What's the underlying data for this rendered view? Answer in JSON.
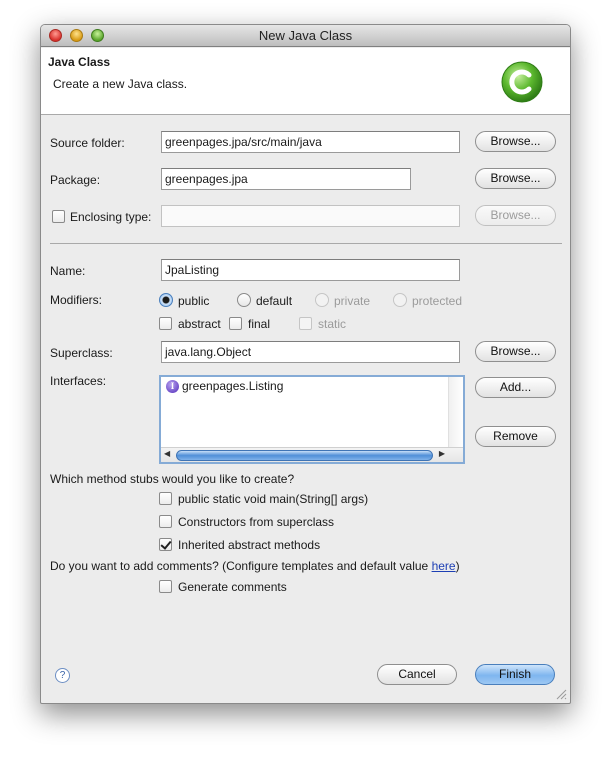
{
  "window": {
    "title": "New Java Class"
  },
  "header": {
    "title": "Java Class",
    "description": "Create a new Java class."
  },
  "source_folder": {
    "label": "Source folder:",
    "value": "greenpages.jpa/src/main/java",
    "browse_label": "Browse..."
  },
  "package": {
    "label": "Package:",
    "value": "greenpages.jpa",
    "browse_label": "Browse..."
  },
  "enclosing_type": {
    "label": "Enclosing type:",
    "value": "",
    "browse_label": "Browse...",
    "checked": false
  },
  "name": {
    "label": "Name:",
    "value": "JpaListing"
  },
  "modifiers": {
    "label": "Modifiers:",
    "access": [
      {
        "label": "public",
        "selected": true,
        "enabled": true
      },
      {
        "label": "default",
        "selected": false,
        "enabled": true
      },
      {
        "label": "private",
        "selected": false,
        "enabled": false
      },
      {
        "label": "protected",
        "selected": false,
        "enabled": false
      }
    ],
    "flags": [
      {
        "label": "abstract",
        "checked": false,
        "enabled": true
      },
      {
        "label": "final",
        "checked": false,
        "enabled": true
      },
      {
        "label": "static",
        "checked": false,
        "enabled": false
      }
    ]
  },
  "superclass": {
    "label": "Superclass:",
    "value": "java.lang.Object",
    "browse_label": "Browse..."
  },
  "interfaces": {
    "label": "Interfaces:",
    "items": [
      {
        "name": "greenpages.Listing",
        "icon": "interface-icon"
      }
    ],
    "add_label": "Add...",
    "remove_label": "Remove"
  },
  "method_stubs": {
    "question": "Which method stubs would you like to create?",
    "options": [
      {
        "label": "public static void main(String[] args)",
        "checked": false
      },
      {
        "label": "Constructors from superclass",
        "checked": false
      },
      {
        "label": "Inherited abstract methods",
        "checked": true
      }
    ]
  },
  "comments": {
    "question_prefix": "Do you want to add comments? (Configure templates and default value ",
    "link_text": "here",
    "question_suffix": ")",
    "option_label": "Generate comments",
    "checked": false
  },
  "footer": {
    "help_symbol": "?",
    "cancel_label": "Cancel",
    "finish_label": "Finish"
  },
  "colors": {
    "accent": "#7fb6ef",
    "link": "#1d3fb4",
    "logo": "#5cb82e"
  }
}
